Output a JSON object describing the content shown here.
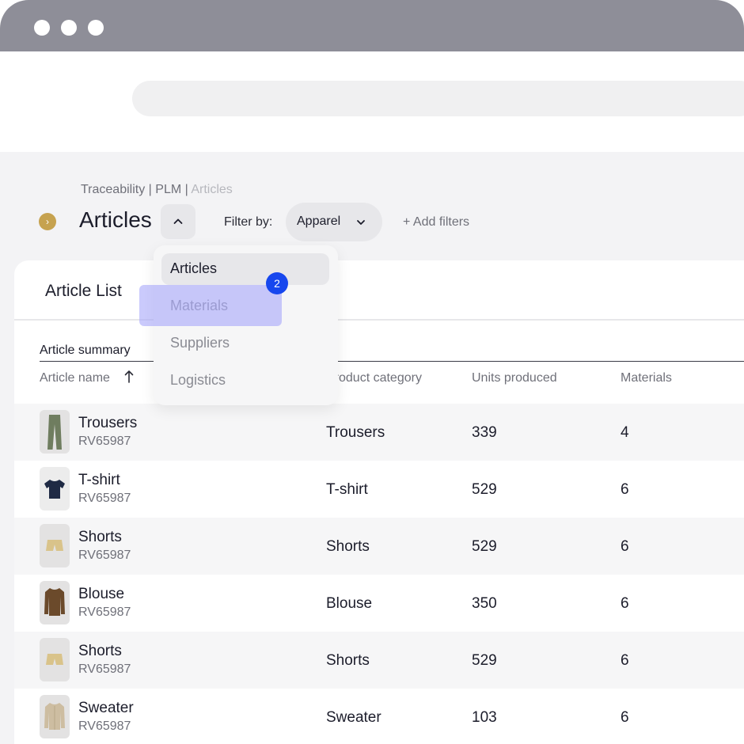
{
  "window": {
    "dots": 3
  },
  "search": {
    "placeholder": ""
  },
  "breadcrumb": {
    "parts": [
      "Traceability",
      "PLM"
    ],
    "separator": " | ",
    "current": "Articles"
  },
  "header": {
    "title": "Articles",
    "filter_label": "Filter by:",
    "filter_value": "Apparel",
    "add_filters": "+ Add filters"
  },
  "dropdown": {
    "items": [
      {
        "label": "Articles",
        "active": true
      },
      {
        "label": "Materials",
        "active": false
      },
      {
        "label": "Suppliers",
        "active": false
      },
      {
        "label": "Logistics",
        "active": false
      }
    ],
    "highlight_badge": "2"
  },
  "card": {
    "title": "Article List",
    "tab": "Article summary"
  },
  "table": {
    "columns": [
      "Article name",
      "Product category",
      "Units produced",
      "Materials"
    ],
    "sort_icon": "arrow-up-icon",
    "rows": [
      {
        "name": "Trousers",
        "code": "RV65987",
        "category": "Trousers",
        "units": "339",
        "materials": "4",
        "thumb": "trousers-icon"
      },
      {
        "name": "T-shirt",
        "code": "RV65987",
        "category": "T-shirt",
        "units": "529",
        "materials": "6",
        "thumb": "tshirt-icon"
      },
      {
        "name": "Shorts",
        "code": "RV65987",
        "category": "Shorts",
        "units": "529",
        "materials": "6",
        "thumb": "shorts-icon"
      },
      {
        "name": "Blouse",
        "code": "RV65987",
        "category": "Blouse",
        "units": "350",
        "materials": "6",
        "thumb": "blouse-icon"
      },
      {
        "name": "Shorts",
        "code": "RV65987",
        "category": "Shorts",
        "units": "529",
        "materials": "6",
        "thumb": "shorts-icon"
      },
      {
        "name": "Sweater",
        "code": "RV65987",
        "category": "Sweater",
        "units": "103",
        "materials": "6",
        "thumb": "sweater-icon"
      }
    ]
  },
  "colors": {
    "accent": "#1747ee",
    "nav_toggle": "#c6a24f",
    "highlight": "#a6a6fa"
  }
}
